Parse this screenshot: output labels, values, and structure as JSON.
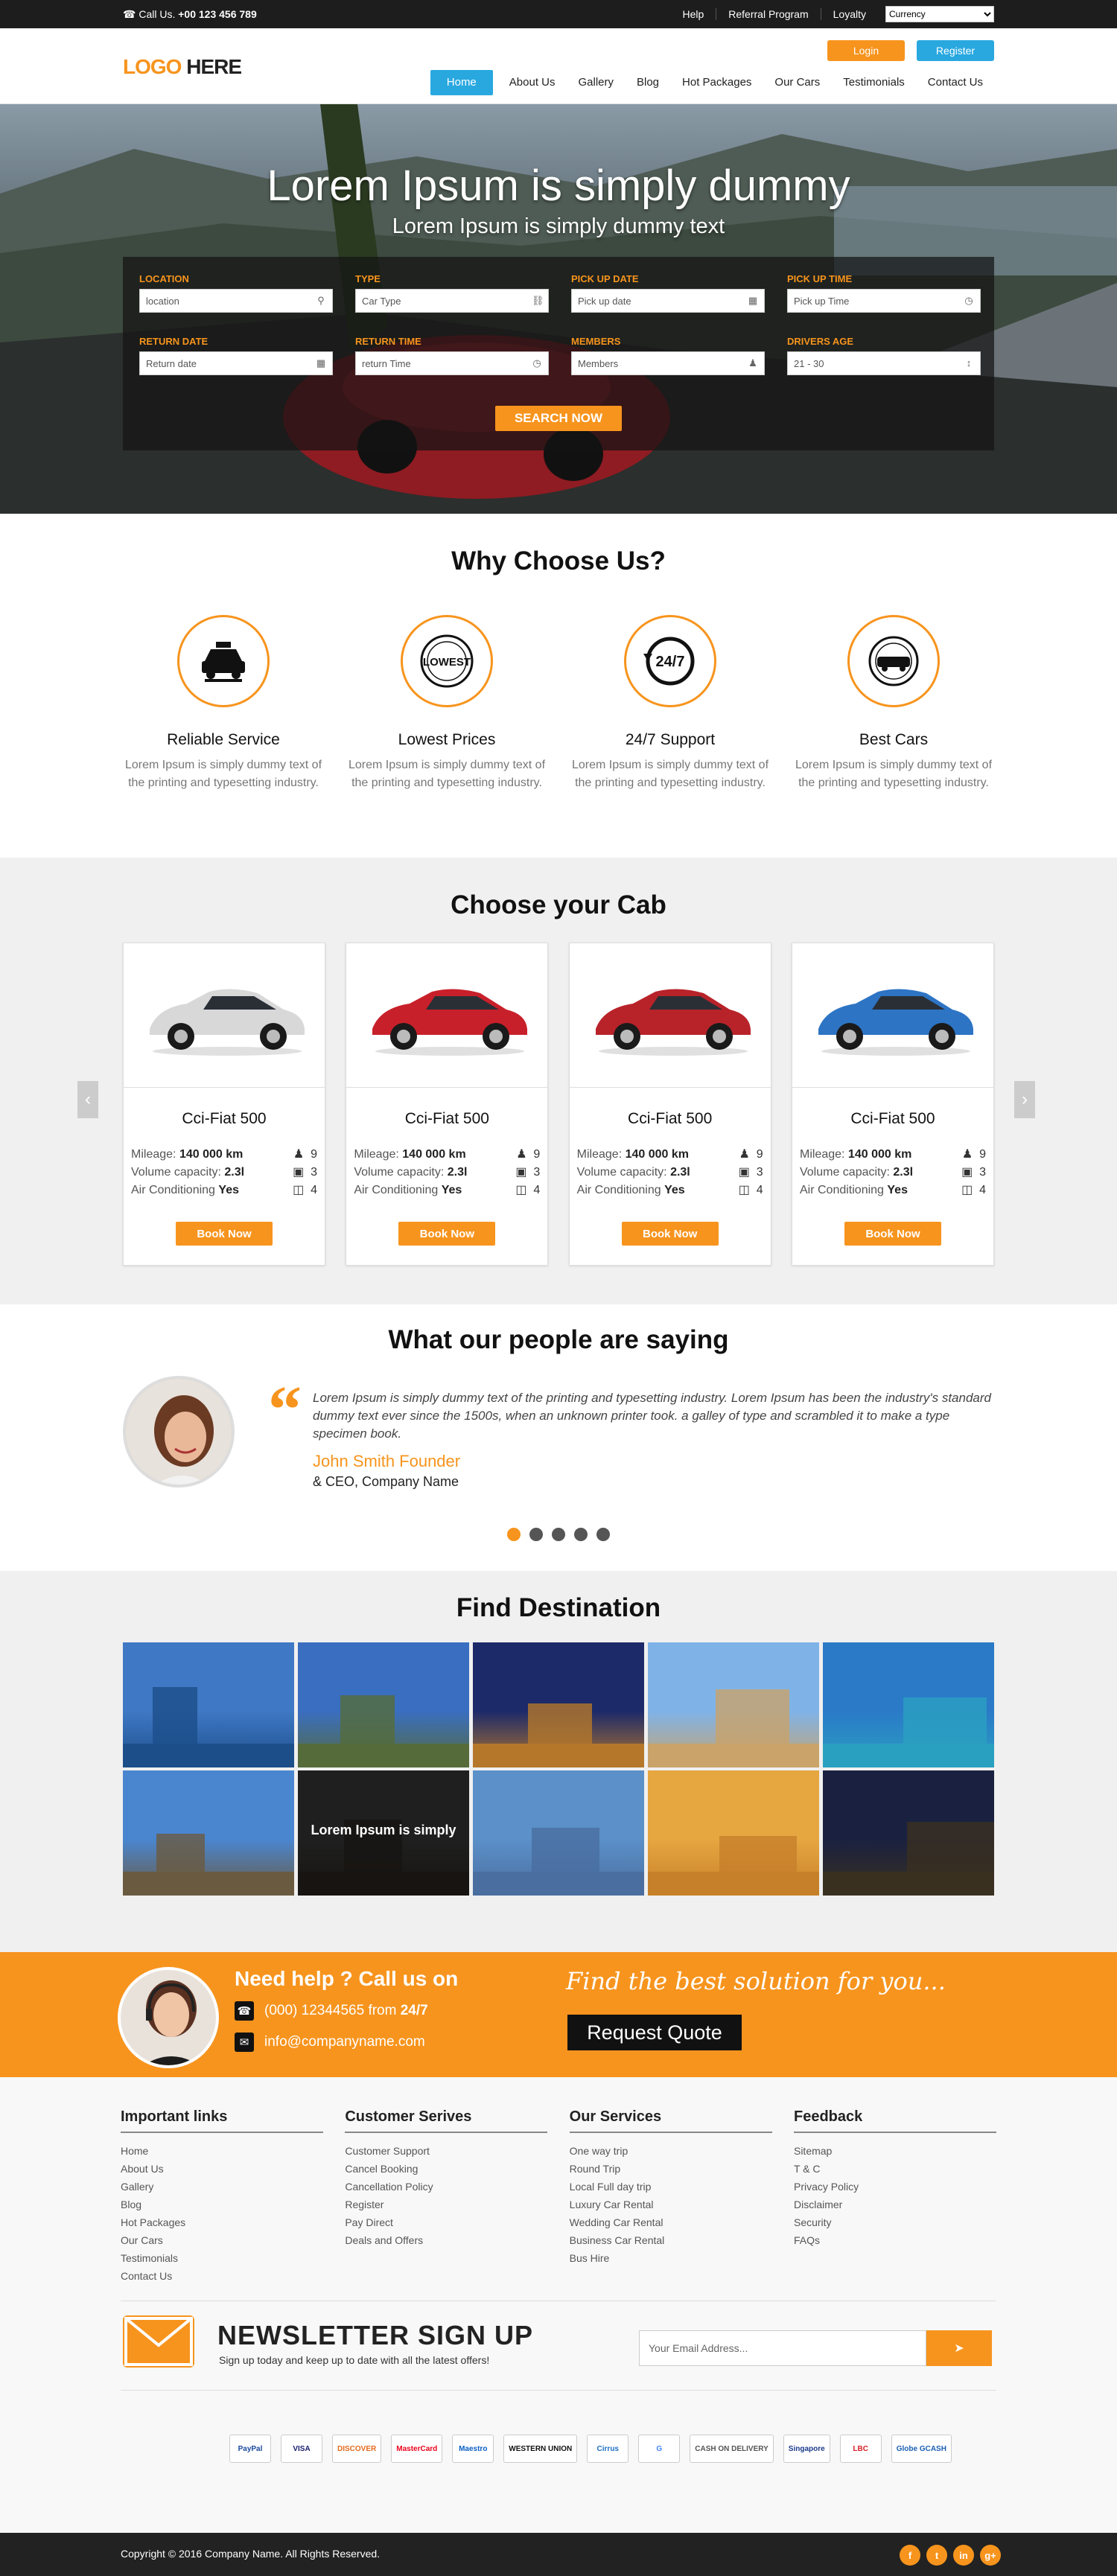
{
  "topbar": {
    "phone_prefix": "Call Us.",
    "phone": "+00 123 456 789",
    "links": [
      "Help",
      "Referral Program",
      "Loyalty"
    ],
    "currency_selected": "Currency"
  },
  "header": {
    "logo_a": "LOGO",
    "logo_b": "HERE",
    "login_label": "Login",
    "register_label": "Register",
    "nav": [
      "Home",
      "About Us",
      "Gallery",
      "Blog",
      "Hot Packages",
      "Our Cars",
      "Testimonials",
      "Contact Us"
    ],
    "active_nav": "Home"
  },
  "hero": {
    "title": "Lorem Ipsum is simply dummy",
    "subtitle": "Lorem Ipsum is simply dummy text",
    "fields": [
      {
        "label": "LOCATION",
        "value": "location",
        "icon": "map-pin-icon"
      },
      {
        "label": "TYPE",
        "value": "Car Type",
        "icon": "car-icon"
      },
      {
        "label": "PICK UP DATE",
        "value": "Pick up date",
        "icon": "calendar-icon"
      },
      {
        "label": "PICK UP TIME",
        "value": "Pick up Time",
        "icon": "clock-icon"
      },
      {
        "label": "RETURN DATE",
        "value": "Return date",
        "icon": "calendar-icon"
      },
      {
        "label": "RETURN TIME",
        "value": "return Time",
        "icon": "clock-icon"
      },
      {
        "label": "MEMBERS",
        "value": "Members",
        "icon": "users-icon"
      },
      {
        "label": "DRIVERS AGE",
        "value": "21 - 30",
        "icon": "spinner-icon"
      }
    ],
    "search_label": "SEARCH NOW"
  },
  "why": {
    "title": "Why Choose Us?",
    "items": [
      {
        "title": "Reliable Service",
        "text": "Lorem Ipsum is simply dummy text of the printing and typesetting industry.",
        "icon": "taxi-icon"
      },
      {
        "title": "Lowest Prices",
        "text": "Lorem Ipsum is simply dummy text of the printing and typesetting industry.",
        "icon": "lowest-price-badge-icon"
      },
      {
        "title": "24/7 Support",
        "text": "Lorem Ipsum is simply dummy text of the printing and typesetting industry.",
        "icon": "support-247-icon"
      },
      {
        "title": "Best Cars",
        "text": "Lorem Ipsum is simply dummy text of the printing and typesetting industry.",
        "icon": "best-cars-badge-icon"
      }
    ],
    "badge_lowest": "LOWEST",
    "badge_247": "24/7"
  },
  "cabs": {
    "title": "Choose your Cab",
    "items": [
      {
        "name": "Cci-Fiat 500",
        "mileage_label": "Mileage:",
        "mileage": "140 000 km",
        "seats": "9",
        "volume_label": "Volume capacity:",
        "volume": "2.3l",
        "bags": "3",
        "ac_label": "Air Conditioning",
        "ac": "Yes",
        "doors": "4",
        "button": "Book Now",
        "color": "#d8d8d8"
      },
      {
        "name": "Cci-Fiat 500",
        "mileage_label": "Mileage:",
        "mileage": "140 000 km",
        "seats": "9",
        "volume_label": "Volume capacity:",
        "volume": "2.3l",
        "bags": "3",
        "ac_label": "Air Conditioning",
        "ac": "Yes",
        "doors": "4",
        "button": "Book Now",
        "color": "#c8202a"
      },
      {
        "name": "Cci-Fiat 500",
        "mileage_label": "Mileage:",
        "mileage": "140 000 km",
        "seats": "9",
        "volume_label": "Volume capacity:",
        "volume": "2.3l",
        "bags": "3",
        "ac_label": "Air Conditioning",
        "ac": "Yes",
        "doors": "4",
        "button": "Book Now",
        "color": "#b8232a"
      },
      {
        "name": "Cci-Fiat 500",
        "mileage_label": "Mileage:",
        "mileage": "140 000 km",
        "seats": "9",
        "volume_label": "Volume capacity:",
        "volume": "2.3l",
        "bags": "3",
        "ac_label": "Air Conditioning",
        "ac": "Yes",
        "doors": "4",
        "button": "Book Now",
        "color": "#2d74c4"
      }
    ]
  },
  "testimonials": {
    "title": "What our people are saying",
    "quote": "Lorem Ipsum is simply dummy text of the printing and typesetting industry. Lorem Ipsum has been the industry's standard dummy text ever since the 1500s, when an unknown printer took. a galley of type and scrambled it to make a type specimen book.",
    "name": "John Smith Founder",
    "role": "& CEO, Company Name",
    "active_dot": 0,
    "dot_count": 5
  },
  "destinations": {
    "title": "Find Destination",
    "hover_caption": "Lorem Ipsum is simply",
    "tiles": [
      {
        "sky": "#3f78c4",
        "ground": "#1c4e8a"
      },
      {
        "sky": "#3a6ec0",
        "ground": "#556b3a"
      },
      {
        "sky": "#1d2a6a",
        "ground": "#b5782a"
      },
      {
        "sky": "#7fb3e8",
        "ground": "#c9a36a"
      },
      {
        "sky": "#2a7ac8",
        "ground": "#2aa0c0"
      },
      {
        "sky": "#4a86d0",
        "ground": "#6a5a40"
      },
      {
        "sky": "#3a3a3a",
        "ground": "#2a2622"
      },
      {
        "sky": "#5b90c8",
        "ground": "#4a6ea0"
      },
      {
        "sky": "#e6a640",
        "ground": "#c7802a"
      },
      {
        "sky": "#1a2140",
        "ground": "#3a3020"
      }
    ]
  },
  "help": {
    "title": "Need help ? Call us on",
    "phone": "(000) 12344565 from",
    "hours": "24/7",
    "email": "info@companyname.com",
    "tagline": "Find the best solution for you...",
    "quote_button": "Request Quote"
  },
  "footer": {
    "columns": [
      {
        "title": "Important links",
        "items": [
          "Home",
          "About Us",
          "Gallery",
          "Blog",
          "Hot Packages",
          "Our Cars",
          "Testimonials",
          "Contact Us"
        ]
      },
      {
        "title": "Customer Serives",
        "items": [
          "Customer Support",
          "Cancel Booking",
          "Cancellation Policy",
          "Register",
          "Pay Direct",
          "Deals and Offers"
        ]
      },
      {
        "title": "Our Services",
        "items": [
          "One way trip",
          "Round Trip",
          "Local Full day trip",
          "Luxury Car Rental",
          "Wedding Car Rental",
          "Business Car Rental",
          "Bus Hire"
        ]
      },
      {
        "title": "Feedback",
        "items": [
          "Sitemap",
          "T & C",
          "Privacy Policy",
          "Disclaimer",
          "Security",
          "FAQs"
        ]
      }
    ],
    "newsletter_title": "NEWSLETTER SIGN UP",
    "newsletter_sub": "Sign up today and keep up to date with all the latest offers!",
    "email_placeholder": "Your Email Address...",
    "payments": [
      "PayPal",
      "VISA",
      "DISCOVER",
      "MasterCard",
      "Maestro",
      "WESTERN UNION",
      "Cirrus",
      "G",
      "CASH ON DELIVERY",
      "Singapore",
      "LBC",
      "Globe GCASH"
    ],
    "copyright": "Copyright © 2016 Company Name. All Rights Reserved.",
    "social": [
      "f",
      "t",
      "in",
      "g+"
    ]
  },
  "colors": {
    "accent": "#f7941d",
    "blue": "#29a8e0",
    "dark": "#1d1d1d"
  }
}
